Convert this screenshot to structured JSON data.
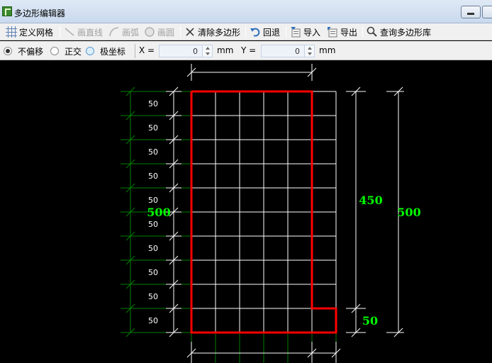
{
  "window": {
    "title": "多边形编辑器"
  },
  "toolbar": {
    "define_grid": "定义网格",
    "draw_line": "画直线",
    "draw_arc": "画弧",
    "draw_circle": "画圆",
    "clear_polygon": "清除多边形",
    "undo": "回退",
    "import": "导入",
    "export": "导出",
    "query_library": "查询多边形库"
  },
  "options": {
    "mode_no_offset": "不偏移",
    "mode_ortho": "正交",
    "mode_polar": "极坐标",
    "selected_mode": "不偏移",
    "x_label": "X =",
    "x_value": "0",
    "x_unit": "mm",
    "y_label": "Y =",
    "y_value": "0",
    "y_unit": "mm"
  },
  "canvas": {
    "row_spacing_labels": [
      "50",
      "50",
      "50",
      "50",
      "50",
      "50",
      "50",
      "50",
      "50",
      "50"
    ],
    "left_total_label": "500",
    "right_upper_label": "450",
    "right_lower_label": "50",
    "right_total_label": "500",
    "colors": {
      "background": "#000000",
      "grid": "#ffffff",
      "polygon": "#ff0000",
      "dimension_text": "#00ff00",
      "dimension_line": "#008000"
    }
  }
}
